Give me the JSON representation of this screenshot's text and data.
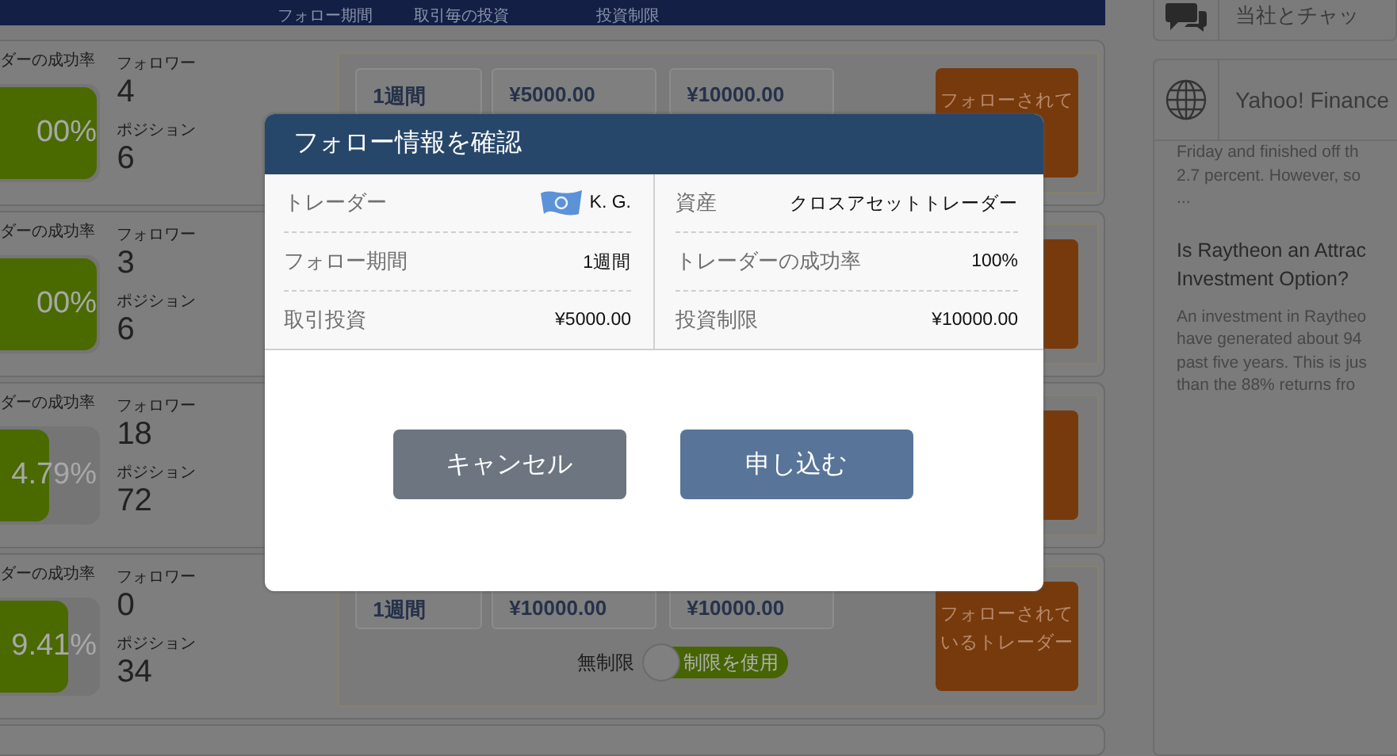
{
  "header_columns": [
    "フォロー期間",
    "取引毎の投資",
    "投資制限"
  ],
  "traders": [
    {
      "success_label": "ダーの成功率",
      "success_rate": "00%",
      "level": 1,
      "followers_label": "フォロワー",
      "followers": "4",
      "positions_label": "ポジション",
      "positions": "6",
      "fields": [
        "1週間",
        "¥5000.00",
        "¥10000.00"
      ],
      "follow_button": [
        "フォローされて"
      ]
    },
    {
      "success_label": "ダーの成功率",
      "success_rate": "00%",
      "level": 1,
      "followers_label": "フォロワー",
      "followers": "3",
      "positions_label": "ポジション",
      "positions": "6"
    },
    {
      "success_label": "ダーの成功率",
      "success_rate": "4.79%",
      "level": 0.5,
      "followers_label": "フォロワー",
      "followers": "18",
      "positions_label": "ポジション",
      "positions": "72"
    },
    {
      "success_label": "ダーの成功率",
      "success_rate": "9.41%",
      "level": 0.7,
      "followers_label": "フォロワー",
      "followers": "0",
      "positions_label": "ポジション",
      "positions": "34",
      "fields": [
        "1週間",
        "¥10000.00",
        "¥10000.00"
      ],
      "follow_button": [
        "フォローされて",
        "いるトレーダー"
      ],
      "limit_toggle": {
        "off_label": "無制限",
        "on_label": "制限を使用",
        "on": true
      }
    }
  ],
  "sidebar": {
    "chat": {
      "label": "当社とチャッ"
    },
    "news": {
      "source": "Yahoo! Finance",
      "excerpt": [
        "Friday and finished off th",
        "2.7 percent. However, so",
        "..."
      ],
      "headline": [
        "Is Raytheon an Attrac",
        "Investment Option?"
      ],
      "summary": [
        "An investment in Raytheo",
        "have generated about 94",
        "past five years. This is jus",
        "than the 88% returns fro"
      ]
    }
  },
  "modal": {
    "title": "フォロー情報を確認",
    "left_rows": [
      {
        "label": "トレーダー",
        "value": "K. G.",
        "kind": "trader"
      },
      {
        "label": "フォロー期間",
        "value": "1週間",
        "kind": "text"
      },
      {
        "label": "取引投資",
        "value": "¥5000.00",
        "kind": "text"
      }
    ],
    "right_rows": [
      {
        "label": "資産",
        "value": "クロスアセットトレーダー",
        "kind": "text"
      },
      {
        "label": "トレーダーの成功率",
        "value": "100%",
        "kind": "text"
      },
      {
        "label": "投資制限",
        "value": "¥10000.00",
        "kind": "text"
      }
    ],
    "buttons": [
      {
        "label": "キャンセル",
        "kind": "cancel"
      },
      {
        "label": "申し込む",
        "kind": "primary"
      }
    ]
  }
}
